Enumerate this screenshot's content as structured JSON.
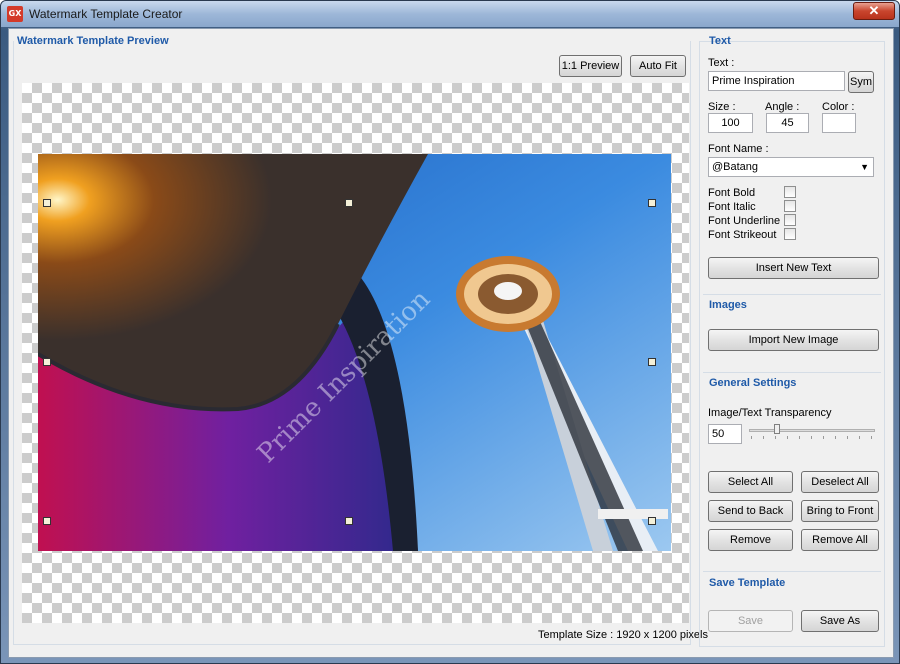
{
  "window": {
    "title": "Watermark Template Creator",
    "icon_text": "GX",
    "close_glyph": "✕"
  },
  "preview": {
    "group_title": "Watermark Template Preview",
    "btn_1to1": "1:1 Preview",
    "btn_autofit": "Auto Fit",
    "watermark_text": "Prime Inspiration",
    "template_size": "Template Size : 1920 x 1200 pixels"
  },
  "text": {
    "group_title": "Text",
    "text_label": "Text :",
    "text_value": "Prime Inspiration",
    "sym_button": "Sym",
    "size_label": "Size :",
    "size_value": "100",
    "angle_label": "Angle :",
    "angle_value": "45",
    "color_label": "Color :",
    "font_name_label": "Font Name :",
    "font_name_value": "@Batang",
    "font_bold": "Font Bold",
    "font_italic": "Font Italic",
    "font_underline": "Font Underline",
    "font_strikeout": "Font Strikeout",
    "insert_button": "Insert New Text"
  },
  "images": {
    "group_title": "Images",
    "import_button": "Import New Image"
  },
  "general": {
    "group_title": "General Settings",
    "transparency_label": "Image/Text Transparency",
    "transparency_value": "50",
    "select_all": "Select All",
    "deselect_all": "Deselect All",
    "send_to_back": "Send to Back",
    "bring_to_front": "Bring to Front",
    "remove": "Remove",
    "remove_all": "Remove All"
  },
  "save": {
    "group_title": "Save Template",
    "save_button": "Save",
    "save_as_button": "Save As"
  },
  "colors": {
    "accent": "#1f5aa8",
    "sky": "#2a78d0"
  }
}
